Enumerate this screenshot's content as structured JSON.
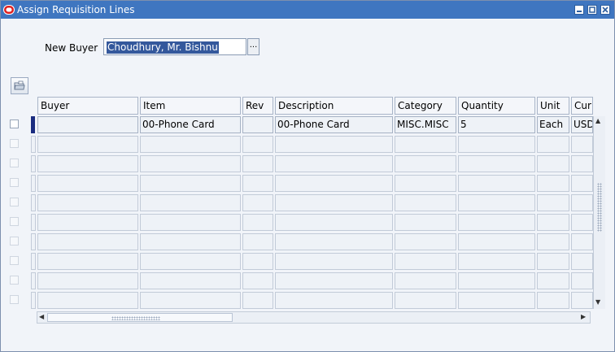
{
  "window": {
    "title": "Assign Requisition Lines",
    "minimize_icon": "minimize-icon",
    "maximize_icon": "maximize-icon",
    "close_icon": "close-icon"
  },
  "new_buyer": {
    "label": "New Buyer",
    "value": "Choudhury, Mr. Bishnu",
    "lov_label": "..."
  },
  "table": {
    "columns": [
      "Buyer",
      "Item",
      "Rev",
      "Description",
      "Category",
      "Quantity",
      "Unit",
      "Cur"
    ],
    "rows": [
      [
        "",
        "00-Phone Card",
        "",
        "00-Phone Card",
        "MISC.MISC",
        "5",
        "Each",
        "USD"
      ],
      [
        "",
        "",
        "",
        "",
        "",
        "",
        "",
        ""
      ],
      [
        "",
        "",
        "",
        "",
        "",
        "",
        "",
        ""
      ],
      [
        "",
        "",
        "",
        "",
        "",
        "",
        "",
        ""
      ],
      [
        "",
        "",
        "",
        "",
        "",
        "",
        "",
        ""
      ],
      [
        "",
        "",
        "",
        "",
        "",
        "",
        "",
        ""
      ],
      [
        "",
        "",
        "",
        "",
        "",
        "",
        "",
        ""
      ],
      [
        "",
        "",
        "",
        "",
        "",
        "",
        "",
        ""
      ],
      [
        "",
        "",
        "",
        "",
        "",
        "",
        "",
        ""
      ],
      [
        "",
        "",
        "",
        "",
        "",
        "",
        "",
        ""
      ]
    ]
  },
  "colors": {
    "titlebar": "#3f76c0",
    "selection": "#34589c",
    "active_row_indicator": "#1a2c80"
  }
}
